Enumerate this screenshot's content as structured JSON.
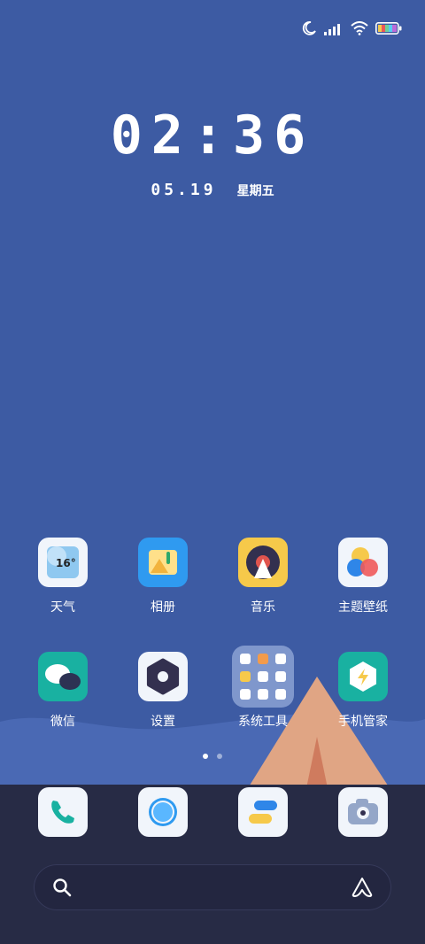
{
  "status_bar": {
    "icons": [
      "moon-icon",
      "signal-icon",
      "wifi-icon",
      "battery-icon"
    ]
  },
  "lockclock": {
    "time": "02:36",
    "date": "05.19",
    "weekday": "星期五"
  },
  "apps": [
    {
      "label": "天气",
      "icon": "weather-icon",
      "temp": "16°"
    },
    {
      "label": "相册",
      "icon": "gallery-icon"
    },
    {
      "label": "音乐",
      "icon": "music-icon"
    },
    {
      "label": "主题壁纸",
      "icon": "theme-icon"
    },
    {
      "label": "微信",
      "icon": "wechat-icon"
    },
    {
      "label": "设置",
      "icon": "settings-icon"
    },
    {
      "label": "系统工具",
      "icon": "folder-icon"
    },
    {
      "label": "手机管家",
      "icon": "phone-manager-icon"
    }
  ],
  "page_indicator": {
    "pages": 2,
    "current": 1
  },
  "dock": [
    "phone-icon",
    "browser-icon",
    "messages-icon",
    "camera-icon"
  ],
  "search": {
    "left_icon": "search-icon",
    "right_icon": "assistant-icon"
  },
  "colors": {
    "background": "#3d5ba3",
    "dock": "#272b45",
    "tent": "#e0a584"
  }
}
